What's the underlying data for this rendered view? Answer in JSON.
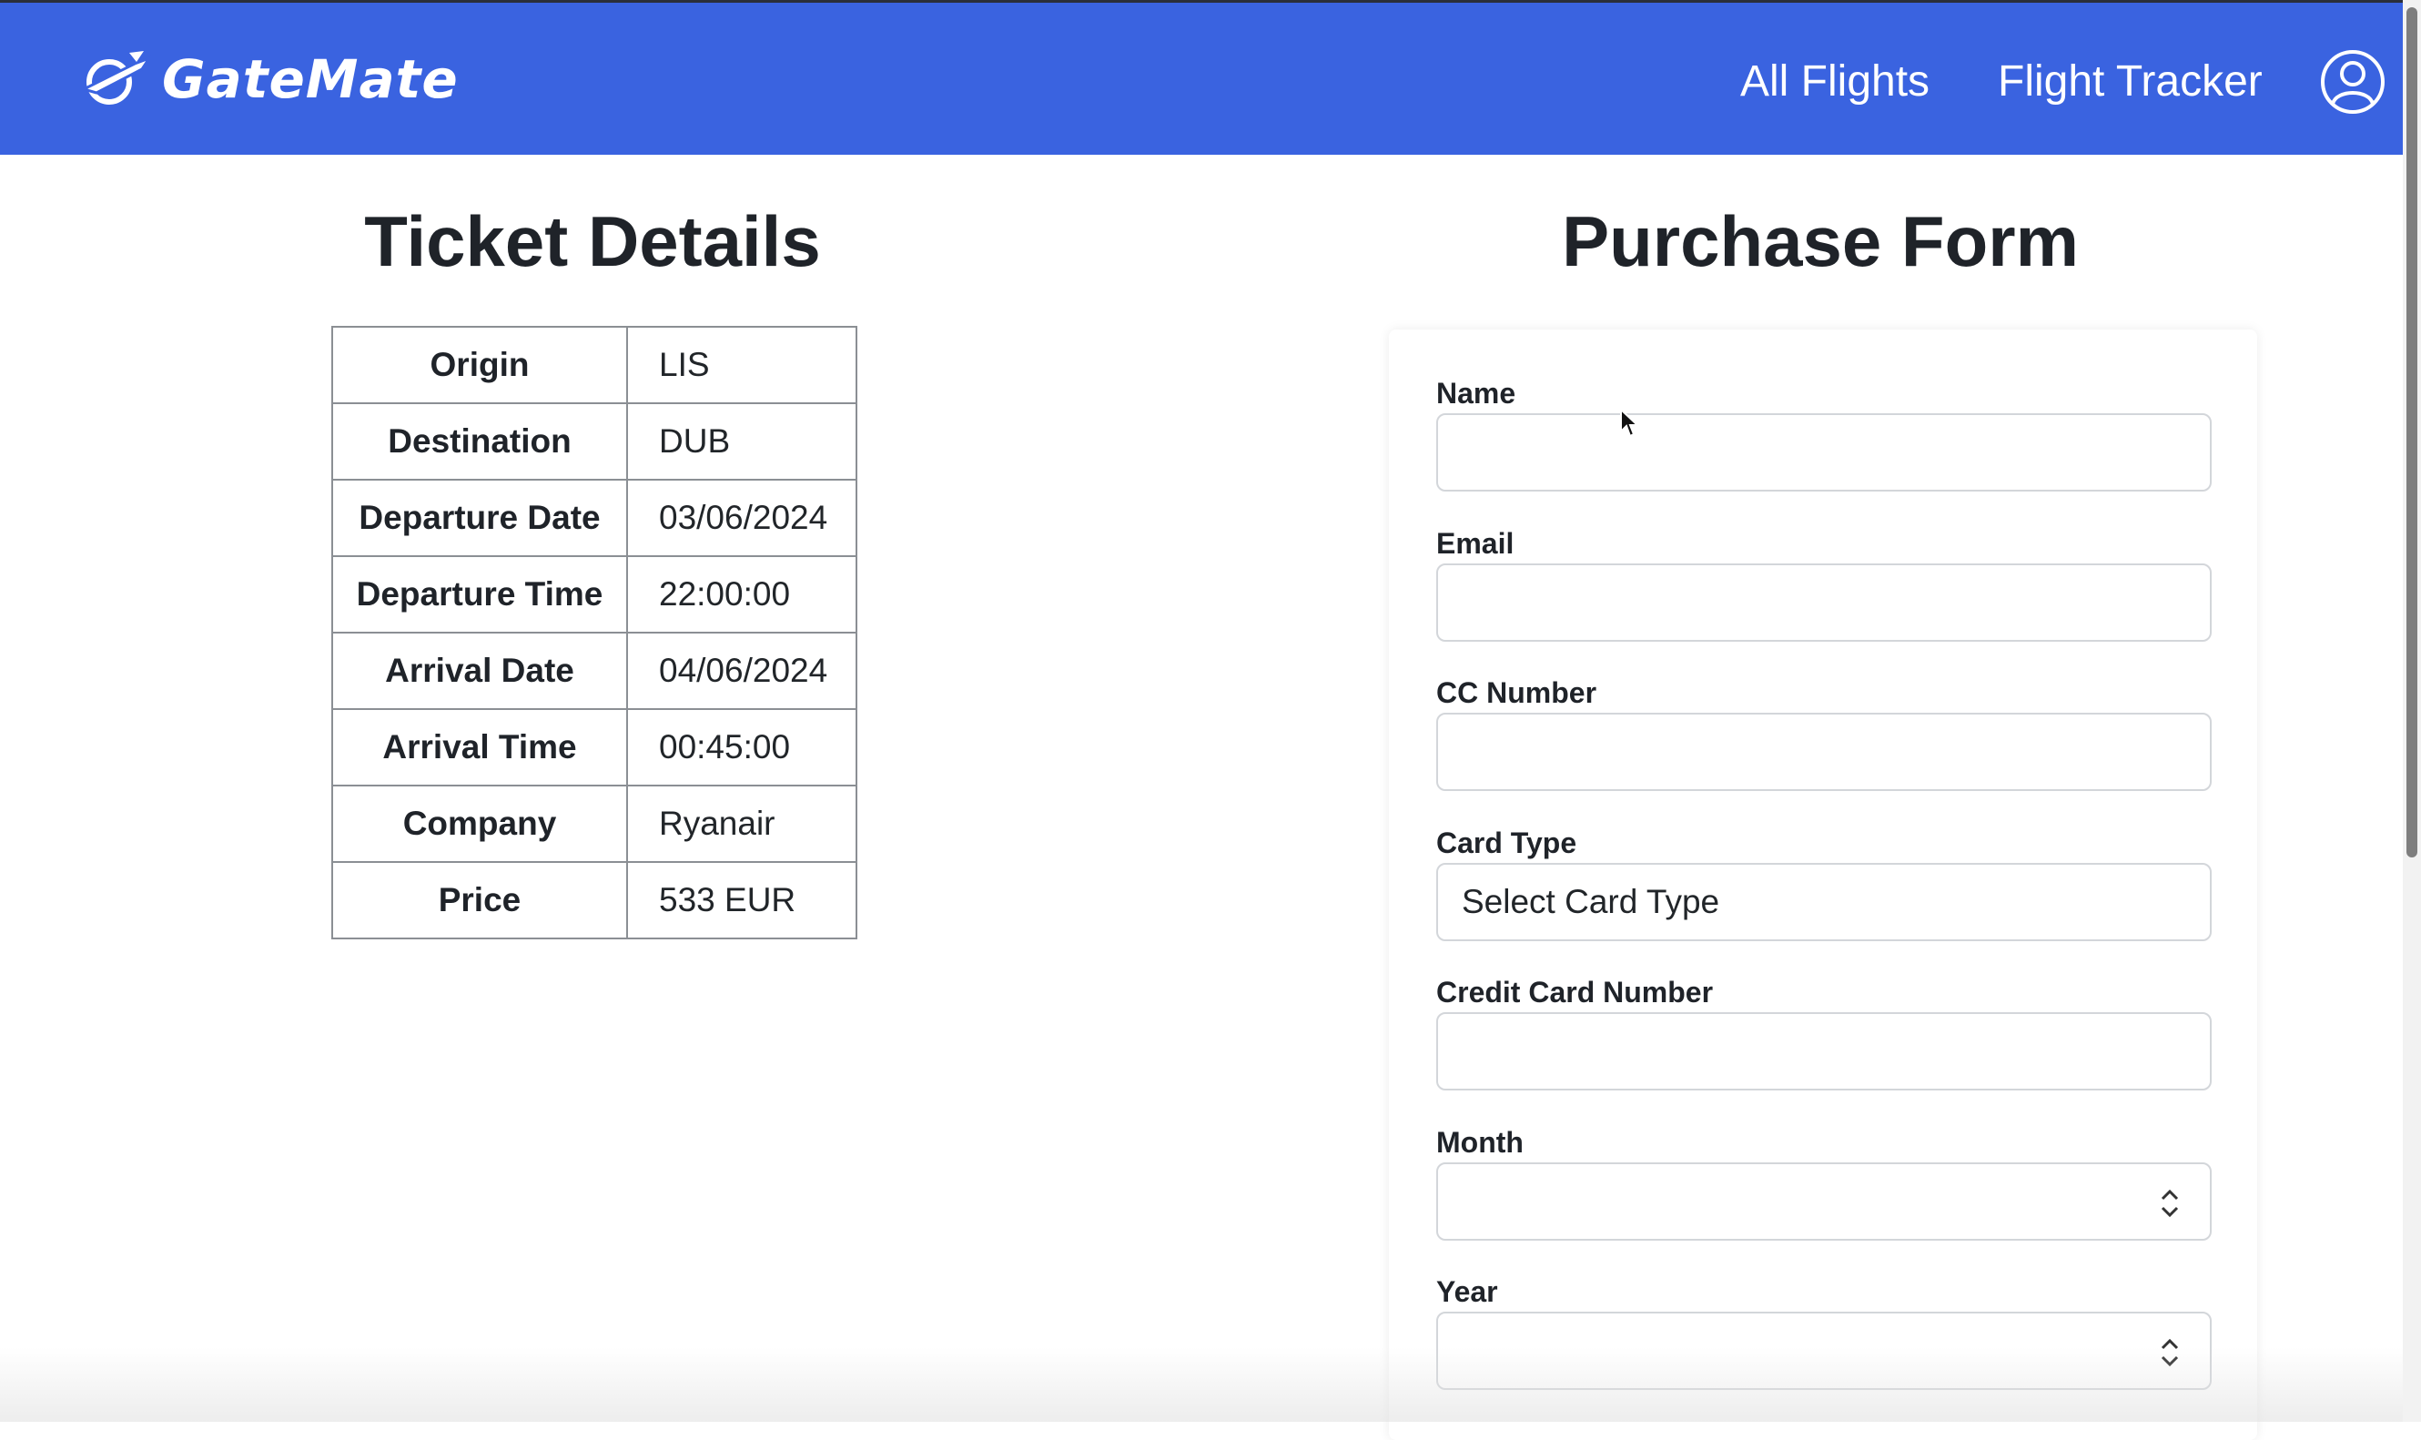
{
  "app": {
    "brand": "GateMate",
    "nav": {
      "all_flights": "All Flights",
      "flight_tracker": "Flight Tracker"
    },
    "icons": {
      "logo": "airplane-logo-icon",
      "profile": "user-profile-icon"
    },
    "colors": {
      "navbar": "#3a63e0",
      "text_dark": "#1f2329"
    }
  },
  "ticket": {
    "title": "Ticket Details",
    "rows": [
      {
        "label": "Origin",
        "value": "LIS"
      },
      {
        "label": "Destination",
        "value": "DUB"
      },
      {
        "label": "Departure Date",
        "value": "03/06/2024"
      },
      {
        "label": "Departure Time",
        "value": "22:00:00"
      },
      {
        "label": "Arrival Date",
        "value": "04/06/2024"
      },
      {
        "label": "Arrival Time",
        "value": "00:45:00"
      },
      {
        "label": "Company",
        "value": "Ryanair"
      },
      {
        "label": "Price",
        "value": "533 EUR"
      }
    ]
  },
  "form": {
    "title": "Purchase Form",
    "name": {
      "label": "Name",
      "value": ""
    },
    "email": {
      "label": "Email",
      "value": ""
    },
    "cc_number": {
      "label": "CC Number",
      "value": ""
    },
    "card_type": {
      "label": "Card Type",
      "selected": "Select Card Type"
    },
    "credit_card_number": {
      "label": "Credit Card Number",
      "value": ""
    },
    "month": {
      "label": "Month",
      "value": ""
    },
    "year": {
      "label": "Year",
      "value": ""
    }
  }
}
